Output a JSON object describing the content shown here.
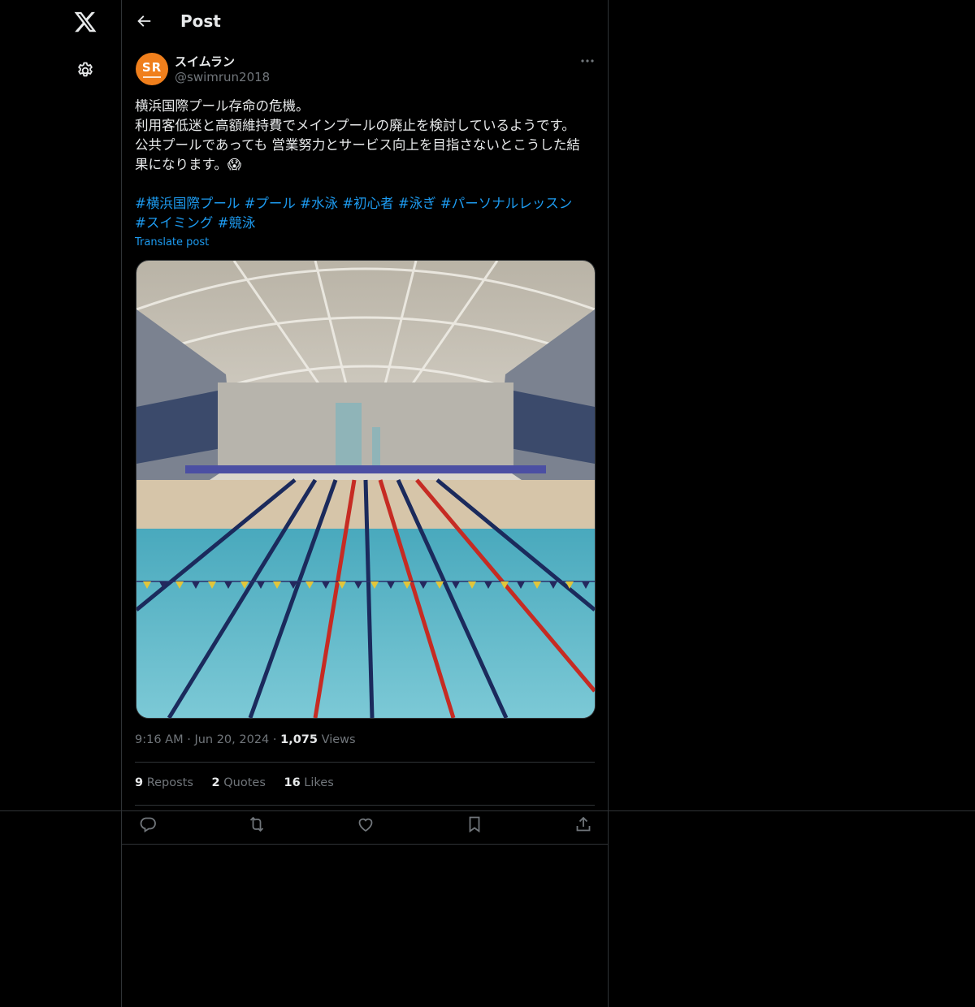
{
  "header": {
    "title": "Post"
  },
  "author": {
    "name": "スイムラン",
    "handle": "@swimrun2018",
    "avatar_text": "SR"
  },
  "post": {
    "lines": [
      "横浜国際プール存命の危機。",
      "利用客低迷と高額維持費でメインプールの廃止を検討しているようです。",
      "公共プールであっても 営業努力とサービス向上を目指さないとこうした結",
      "果になります。😱"
    ],
    "hashtags": [
      "#横浜国際プール",
      "#プール",
      "#水泳",
      "#初心者",
      "#泳ぎ",
      "#パーソナルレッスン",
      "#スイミング",
      "#競泳"
    ],
    "translate": "Translate post",
    "time": "9:16 AM",
    "date": "Jun 20, 2024",
    "views_count": "1,075",
    "views_label": "Views",
    "dot": "·"
  },
  "stats": {
    "reposts_count": "9",
    "reposts_label": "Reposts",
    "quotes_count": "2",
    "quotes_label": "Quotes",
    "likes_count": "16",
    "likes_label": "Likes"
  },
  "icons": {
    "logo": "x-logo-icon",
    "settings": "gear-icon",
    "back": "arrow-left-icon",
    "more": "more-icon",
    "reply": "reply-icon",
    "repost": "repost-icon",
    "like": "heart-icon",
    "bookmark": "bookmark-icon",
    "share": "share-icon"
  },
  "colors": {
    "background": "#000000",
    "link": "#1d9bf0",
    "muted": "#71767b",
    "text": "#e7e9ea",
    "avatar": "#f07f1c"
  }
}
